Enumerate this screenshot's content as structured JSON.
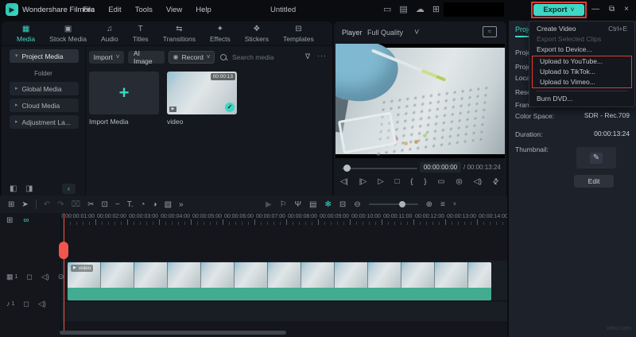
{
  "colors": {
    "accent": "#3fd6c4",
    "annotation_red": "#e23b35",
    "clip_teal": "#43ab91",
    "playhead_red": "#f0564c"
  },
  "window": {
    "app_name": "Wondershare Filmora",
    "menus": [
      "File",
      "Edit",
      "Tools",
      "View",
      "Help"
    ],
    "doc_title": "Untitled",
    "titlebar_icons": [
      "layout-icon",
      "save-icon",
      "cloud-upload-icon",
      "workspace-icon"
    ],
    "export_label": "Export",
    "window_controls": [
      "minimize-icon",
      "restore-icon",
      "close-icon"
    ]
  },
  "export_menu": {
    "items": [
      {
        "label": "Create Video",
        "shortcut": "Ctrl+E",
        "section": "top"
      },
      {
        "label": "Export Selected Clips",
        "disabled": true,
        "section": "top"
      },
      {
        "label": "Export to Device...",
        "section": "top"
      },
      {
        "label": "Upload to YouTube...",
        "section": "boxed"
      },
      {
        "label": "Upload to TikTok...",
        "section": "boxed"
      },
      {
        "label": "Upload to Vimeo...",
        "section": "boxed"
      },
      {
        "label": "Burn DVD...",
        "section": "bottom"
      }
    ]
  },
  "tabs": [
    {
      "label": "Media",
      "icon": "media-tab-icon",
      "active": true
    },
    {
      "label": "Stock Media",
      "icon": "stock-media-tab-icon"
    },
    {
      "label": "Audio",
      "icon": "audio-tab-icon"
    },
    {
      "label": "Titles",
      "icon": "titles-tab-icon"
    },
    {
      "label": "Transitions",
      "icon": "transitions-tab-icon"
    },
    {
      "label": "Effects",
      "icon": "effects-tab-icon"
    },
    {
      "label": "Stickers",
      "icon": "stickers-tab-icon"
    },
    {
      "label": "Templates",
      "icon": "templates-tab-icon"
    }
  ],
  "sidebar": {
    "items": [
      {
        "label": "Project Media",
        "type": "selected"
      },
      {
        "label": "Folder",
        "type": "section"
      },
      {
        "label": "Global Media"
      },
      {
        "label": "Cloud Media"
      },
      {
        "label": "Adjustment La..."
      }
    ],
    "bottom_icons": [
      "new-folder-icon",
      "folder-icon"
    ],
    "collapse_icon": "collapse-panel-icon"
  },
  "media": {
    "toolbar": {
      "import_label": "Import",
      "ai_image_label": "AI Image",
      "record_label": "Record",
      "search_placeholder": "Search media"
    },
    "items": [
      {
        "type": "import",
        "label": "Import Media"
      },
      {
        "type": "video",
        "label": "video",
        "duration": "00:00:13",
        "selected": true
      }
    ]
  },
  "player": {
    "label": "Player",
    "quality": "Full Quality",
    "current_time": "00:00:00:00",
    "total_time": "00:00:13:24",
    "controls": [
      "step-back-icon",
      "step-forward-icon",
      "play-icon",
      "stop-icon",
      "mark-in-icon",
      "mark-out-icon",
      "mirror-display-icon",
      "snapshot-icon",
      "speaker-icon",
      "fullscreen-icon"
    ]
  },
  "properties": {
    "tab": "Project",
    "rows": [
      {
        "label": "Project Name:",
        "value": ""
      },
      {
        "label": "Project Location:",
        "value": ""
      },
      {
        "label": "Resolution:",
        "value": ""
      },
      {
        "label": "Frame Rate:",
        "value": ""
      },
      {
        "label": "Color Space:",
        "value": "SDR - Rec.709"
      },
      {
        "label": "Duration:",
        "value": "00:00:13:24"
      }
    ],
    "thumbnail_label": "Thumbnail:",
    "edit_label": "Edit"
  },
  "timeline": {
    "toolbar_left": [
      {
        "icon": "toolbox-icon"
      },
      {
        "icon": "select-tool-icon"
      },
      {
        "icon": "separator"
      },
      {
        "icon": "undo-icon",
        "disabled": true
      },
      {
        "icon": "redo-icon",
        "disabled": true
      },
      {
        "icon": "delete-icon",
        "disabled": true
      },
      {
        "icon": "split-icon"
      },
      {
        "icon": "crop-icon"
      },
      {
        "icon": "speed-ramp-icon"
      },
      {
        "icon": "text-tool-icon"
      },
      {
        "icon": "speed-icon"
      },
      {
        "icon": "color-icon"
      },
      {
        "icon": "chroma-key-icon"
      },
      {
        "icon": "more-tools-icon"
      }
    ],
    "toolbar_right": [
      {
        "icon": "render-preview-icon",
        "disabled": true
      },
      {
        "icon": "marker-icon"
      },
      {
        "icon": "voiceover-icon"
      },
      {
        "icon": "mixer-icon"
      },
      {
        "icon": "keyframe-icon",
        "accent": true
      },
      {
        "icon": "preview-quality-icon"
      },
      {
        "icon": "zoom-out-icon"
      },
      {
        "icon": "zoom-slider"
      },
      {
        "icon": "zoom-in-icon"
      },
      {
        "icon": "track-manager-icon"
      }
    ],
    "header_icons": [
      "add-track-icon",
      "link-icon"
    ],
    "ruler": [
      "00:00:00:00",
      "00:00:01:00",
      "00:00:02:00",
      "00:00:03:00",
      "00:00:04:00",
      "00:00:05:00",
      "00:00:06:00",
      "00:00:07:00",
      "00:00:08:00",
      "00:00:09:00",
      "00:00:10:00",
      "00:00:11:00",
      "00:00:12:00",
      "00:00:13:00",
      "00:00:14:00"
    ],
    "tracks": [
      {
        "name": "video-track",
        "index": "1",
        "icons": [
          "video-track-icon",
          "lock-icon",
          "mute-icon",
          "eye-icon"
        ]
      },
      {
        "name": "audio-track",
        "index": "1",
        "icons": [
          "music-track-icon",
          "lock-icon",
          "mute-icon"
        ]
      }
    ],
    "clip": {
      "label": "video",
      "thumbnail_count": 13
    }
  },
  "watermark": "wfxsl.com"
}
